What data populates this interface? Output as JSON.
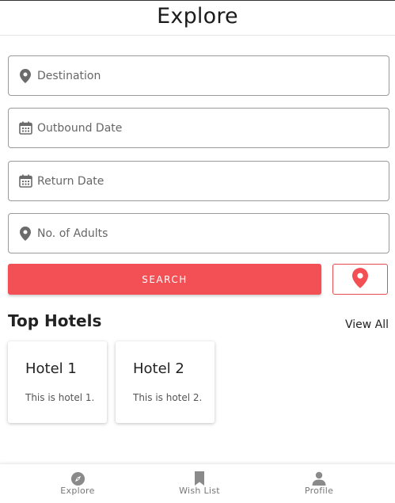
{
  "header": {
    "title": "Explore"
  },
  "form": {
    "destination": {
      "placeholder": "Destination",
      "value": "",
      "icon": "location-pin-icon"
    },
    "outbound": {
      "placeholder": "Outbound Date",
      "value": "",
      "icon": "calendar-icon"
    },
    "return": {
      "placeholder": "Return Date",
      "value": "",
      "icon": "calendar-icon"
    },
    "adults": {
      "placeholder": "No. of Adults",
      "value": "",
      "icon": "location-pin-icon"
    },
    "search_label": "SEARCH",
    "map_icon": "location-pin-icon"
  },
  "top_hotels": {
    "title": "Top Hotels",
    "view_all": "View All",
    "hotels": [
      {
        "name": "Hotel 1",
        "description": "This is hotel 1."
      },
      {
        "name": "Hotel 2",
        "description": "This is hotel 2."
      }
    ]
  },
  "tabs": [
    {
      "label": "Explore",
      "icon": "compass-icon"
    },
    {
      "label": "Wish List",
      "icon": "bookmark-icon"
    },
    {
      "label": "Profile",
      "icon": "person-icon"
    }
  ],
  "colors": {
    "accent": "#f25055",
    "icon_gray": "#6b6b6b",
    "tab_icon": "#8a8a8a"
  }
}
